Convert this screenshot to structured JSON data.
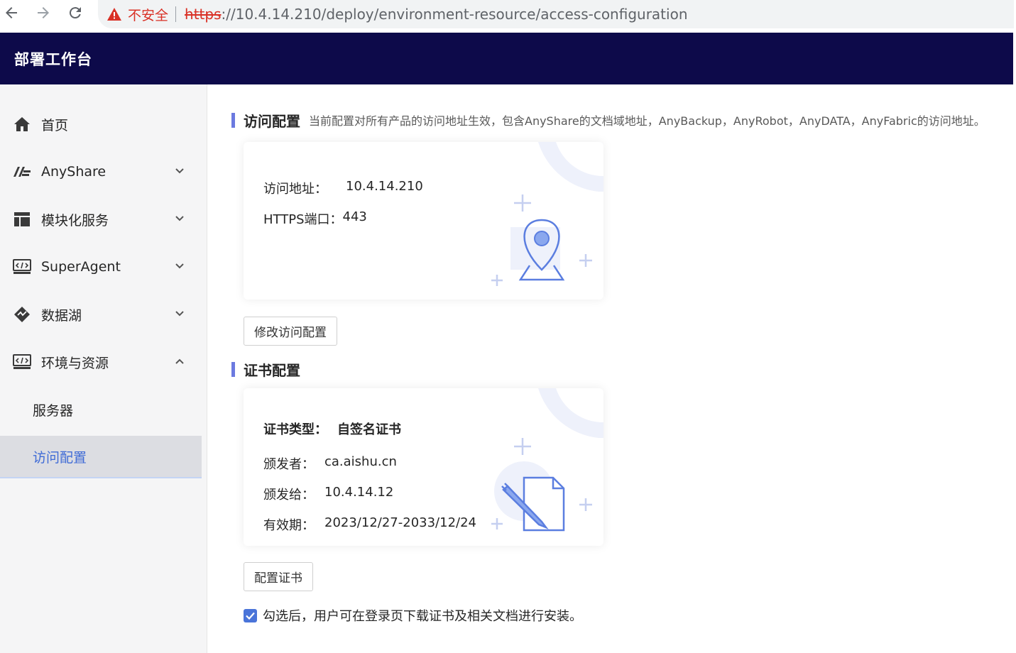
{
  "browser": {
    "warning": "不安全",
    "url_scheme": "https",
    "url_rest": "://10.4.14.210/deploy/environment-resource/access-configuration"
  },
  "header": {
    "title": "部署工作台"
  },
  "sidebar": {
    "items": [
      {
        "label": "首页",
        "icon": "home-icon"
      },
      {
        "label": "AnyShare",
        "icon": "anyshare-icon",
        "expanded": false
      },
      {
        "label": "模块化服务",
        "icon": "module-icon",
        "expanded": false
      },
      {
        "label": "SuperAgent",
        "icon": "code-monitor-icon",
        "expanded": false
      },
      {
        "label": "数据湖",
        "icon": "data-lake-icon",
        "expanded": false
      },
      {
        "label": "环境与资源",
        "icon": "code-monitor-icon",
        "expanded": true
      }
    ],
    "sub_items": [
      {
        "label": "服务器"
      },
      {
        "label": "访问配置",
        "active": true
      }
    ]
  },
  "access": {
    "title": "访问配置",
    "description": "当前配置对所有产品的访问地址生效，包含AnyShare的文档域地址，AnyBackup，AnyRobot，AnyDATA，AnyFabric的访问地址。",
    "address_label": "访问地址：",
    "address_value": "10.4.14.210",
    "port_label": "HTTPS端口：",
    "port_value": "443",
    "edit_button": "修改访问配置"
  },
  "cert": {
    "title": "证书配置",
    "type_label": "证书类型：",
    "type_value": "自签名证书",
    "issuer_label": "颁发者：",
    "issuer_value": "ca.aishu.cn",
    "issued_to_label": "颁发给：",
    "issued_to_value": "10.4.14.12",
    "validity_label": "有效期：",
    "validity_value": "2023/12/27-2033/12/24",
    "config_button": "配置证书",
    "checkbox_label": "勾选后，用户可在登录页下载证书及相关文档进行安装。",
    "checkbox_checked": true
  },
  "colors": {
    "header_bg": "#0d0a4a",
    "accent": "#4a74d9",
    "active_text": "#3f6bd6",
    "warning": "#d93025"
  }
}
